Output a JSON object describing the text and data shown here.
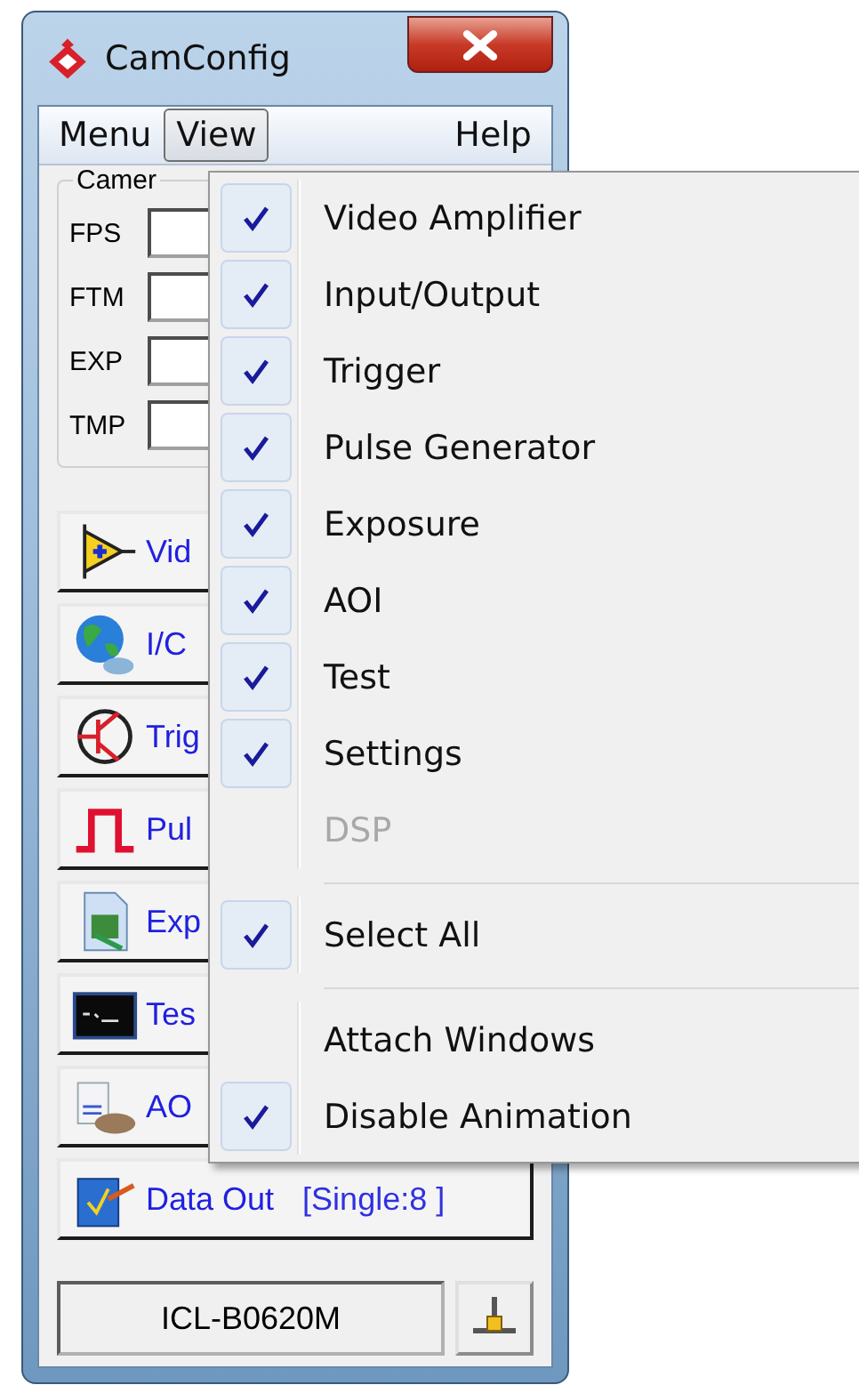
{
  "window": {
    "title": "CamConfig"
  },
  "menubar": [
    {
      "label": "Menu",
      "selected": false
    },
    {
      "label": "View",
      "selected": true
    },
    {
      "label": "Help",
      "selected": false
    }
  ],
  "camera_group": {
    "title": "Camer",
    "fields": [
      {
        "label": "FPS"
      },
      {
        "label": "FTM"
      },
      {
        "label": "EXP"
      },
      {
        "label": "TMP"
      }
    ]
  },
  "module_buttons": [
    {
      "kind": "amplifier",
      "label": "Vid"
    },
    {
      "kind": "globe",
      "label": "I/C"
    },
    {
      "kind": "transistor",
      "label": "Trig"
    },
    {
      "kind": "pulse",
      "label": "Pul"
    },
    {
      "kind": "document",
      "label": "Exp"
    },
    {
      "kind": "terminal",
      "label": "Tes"
    },
    {
      "kind": "aoi",
      "label": "AO"
    },
    {
      "kind": "dataout",
      "label": "Data Out",
      "detail": "[Single:8 ]"
    }
  ],
  "status_bar": {
    "camera": "ICL-B0620M"
  },
  "view_menu": {
    "items": [
      {
        "kind": "item",
        "label": "Video Amplifier",
        "checked": true,
        "disabled": false
      },
      {
        "kind": "item",
        "label": "Input/Output",
        "checked": true,
        "disabled": false
      },
      {
        "kind": "item",
        "label": "Trigger",
        "checked": true,
        "disabled": false
      },
      {
        "kind": "item",
        "label": "Pulse Generator",
        "checked": true,
        "disabled": false
      },
      {
        "kind": "item",
        "label": "Exposure",
        "checked": true,
        "disabled": false
      },
      {
        "kind": "item",
        "label": "AOI",
        "checked": true,
        "disabled": false
      },
      {
        "kind": "item",
        "label": "Test",
        "checked": true,
        "disabled": false
      },
      {
        "kind": "item",
        "label": "Settings",
        "checked": true,
        "disabled": false
      },
      {
        "kind": "item",
        "label": "DSP",
        "checked": false,
        "disabled": true
      },
      {
        "kind": "separator"
      },
      {
        "kind": "item",
        "label": "Select All",
        "checked": true,
        "disabled": false
      },
      {
        "kind": "separator"
      },
      {
        "kind": "item",
        "label": "Attach Windows",
        "checked": false,
        "disabled": false
      },
      {
        "kind": "item",
        "label": "Disable Animation",
        "checked": true,
        "disabled": false
      }
    ]
  }
}
